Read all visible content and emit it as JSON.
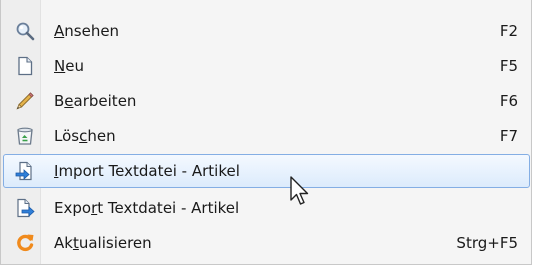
{
  "menu": {
    "items": [
      {
        "pre": "",
        "u": "A",
        "post": "nsehen",
        "shortcut": "F2",
        "icon": "magnifier-icon"
      },
      {
        "pre": "",
        "u": "N",
        "post": "eu",
        "shortcut": "F5",
        "icon": "new-document-icon"
      },
      {
        "pre": "B",
        "u": "e",
        "post": "arbeiten",
        "shortcut": "F6",
        "icon": "pencil-icon"
      },
      {
        "pre": "Lös",
        "u": "c",
        "post": "hen",
        "shortcut": "F7",
        "icon": "recycle-bin-icon"
      },
      {
        "pre": "",
        "u": "I",
        "post": "mport Textdatei - Artikel",
        "shortcut": "",
        "icon": "import-icon"
      },
      {
        "pre": "Expo",
        "u": "r",
        "post": "t Textdatei - Artikel",
        "shortcut": "",
        "icon": "export-icon"
      },
      {
        "pre": "Ak",
        "u": "t",
        "post": "ualisieren",
        "shortcut": "Strg+F5",
        "icon": "refresh-icon"
      }
    ],
    "highlighted_index": 4,
    "colors": {
      "highlight_border": "#84aee4",
      "highlight_fill": "#dcebfc",
      "refresh_orange": "#f08a1c"
    }
  }
}
